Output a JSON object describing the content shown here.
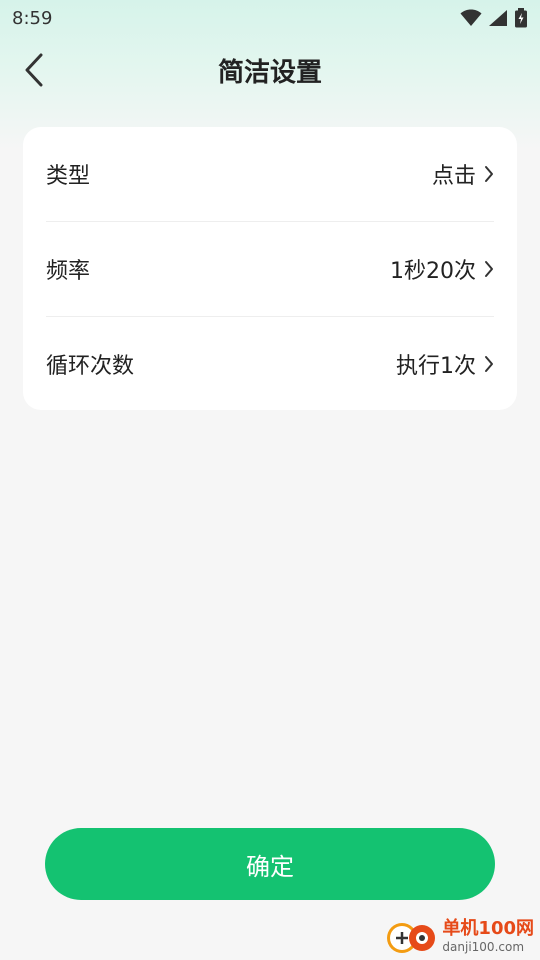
{
  "status_bar": {
    "time": "8:59"
  },
  "header": {
    "title": "简洁设置"
  },
  "settings": [
    {
      "label": "类型",
      "value": "点击"
    },
    {
      "label": "频率",
      "value": "1秒20次"
    },
    {
      "label": "循环次数",
      "value": "执行1次"
    }
  ],
  "confirm_label": "确定",
  "watermark": {
    "name": "单机100网",
    "domain": "danji100.com"
  },
  "colors": {
    "accent": "#14c271",
    "background": "#f6f6f6",
    "card": "#ffffff"
  },
  "icons": [
    "wifi-icon",
    "cell-signal-icon",
    "battery-icon",
    "back-arrow-icon",
    "chevron-right-icon"
  ]
}
